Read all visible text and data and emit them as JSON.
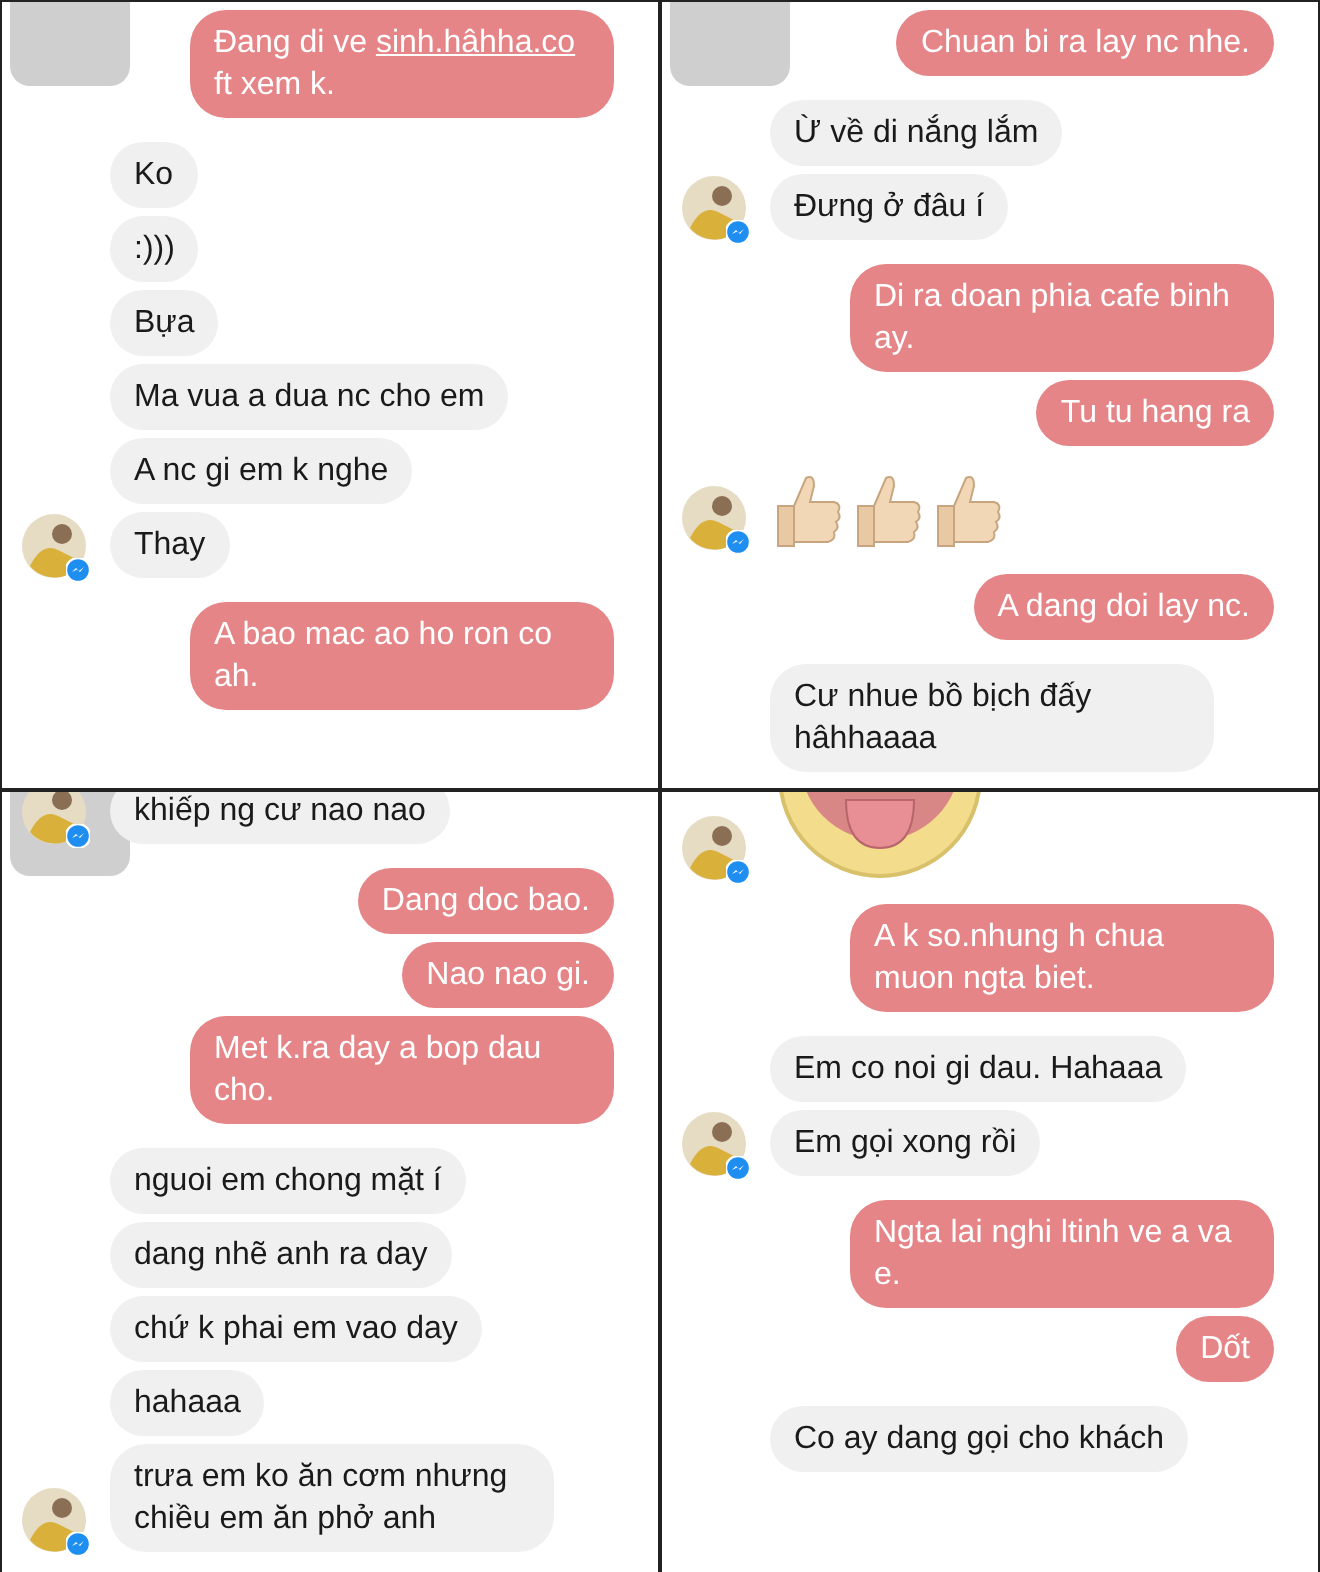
{
  "panels": [
    {
      "corner_tile": true,
      "cut_top": false,
      "messages": [
        {
          "kind": "sent",
          "before": "Đang di ve ",
          "link": "sinh.hâhha.co",
          "after": " ft xem k."
        },
        {
          "kind": "received",
          "text": "Ko",
          "avatar": false
        },
        {
          "kind": "received",
          "text": ":)))",
          "avatar": false
        },
        {
          "kind": "received",
          "text": "Bựa",
          "avatar": false
        },
        {
          "kind": "received",
          "text": "Ma vua a dua nc cho em",
          "avatar": false
        },
        {
          "kind": "received",
          "text": "A nc gi em k nghe",
          "avatar": false
        },
        {
          "kind": "received",
          "text": "Thay",
          "avatar": true
        },
        {
          "kind": "sent",
          "text": "A bao mac ao ho ron co ah."
        }
      ]
    },
    {
      "corner_tile": true,
      "cut_top": false,
      "messages": [
        {
          "kind": "sent",
          "text": "Chuan bi ra lay nc nhe."
        },
        {
          "kind": "received",
          "text": "Ừ về di nắng lắm",
          "avatar": false
        },
        {
          "kind": "received",
          "text": "Đưng ở đâu í",
          "avatar": true
        },
        {
          "kind": "sent",
          "text": "Di ra doan phia cafe binh ay."
        },
        {
          "kind": "sent",
          "text": "Tu tu hang ra"
        },
        {
          "kind": "emoji",
          "icons": [
            {
              "kind": "thumbs_up"
            },
            {
              "kind": "thumbs_up"
            },
            {
              "kind": "thumbs_up"
            }
          ],
          "avatar": true
        },
        {
          "kind": "sent",
          "text": "A dang doi lay nc."
        },
        {
          "kind": "received",
          "text": "Cư nhue bồ bịch đấy hâhhaaaa",
          "avatar": false
        }
      ]
    },
    {
      "corner_tile": true,
      "cut_top": true,
      "messages": [
        {
          "kind": "received",
          "text": "khiếp ng cư nao nao",
          "avatar": true
        },
        {
          "kind": "sent",
          "text": "Dang doc bao."
        },
        {
          "kind": "sent",
          "text": "Nao nao gi."
        },
        {
          "kind": "sent",
          "text": "Met k.ra day a bop dau cho."
        },
        {
          "kind": "received",
          "text": "nguoi em chong mặt í",
          "avatar": false
        },
        {
          "kind": "received",
          "text": "dang nhẽ anh ra day",
          "avatar": false
        },
        {
          "kind": "received",
          "text": "chứ k phai em vao day",
          "avatar": false
        },
        {
          "kind": "received",
          "text": "hahaaa",
          "avatar": false
        },
        {
          "kind": "received",
          "text": "trưa em ko ăn cơm nhưng chiều em ăn phở anh",
          "avatar": true
        }
      ]
    },
    {
      "corner_tile": false,
      "cut_top": true,
      "messages": [
        {
          "kind": "sticker",
          "avatar": true
        },
        {
          "kind": "sent",
          "text": "A k so.nhung h chua muon ngta biet."
        },
        {
          "kind": "received",
          "text": "Em co noi gi dau. Hahaaa",
          "avatar": false
        },
        {
          "kind": "received",
          "text": "Em gọi xong rồi",
          "avatar": true
        },
        {
          "kind": "sent",
          "text": "Ngta lai nghi ltinh ve a va e."
        },
        {
          "kind": "sent",
          "text": "Dốt"
        },
        {
          "kind": "received",
          "text": "Co ay dang gọi cho khách",
          "avatar": false
        }
      ]
    }
  ]
}
